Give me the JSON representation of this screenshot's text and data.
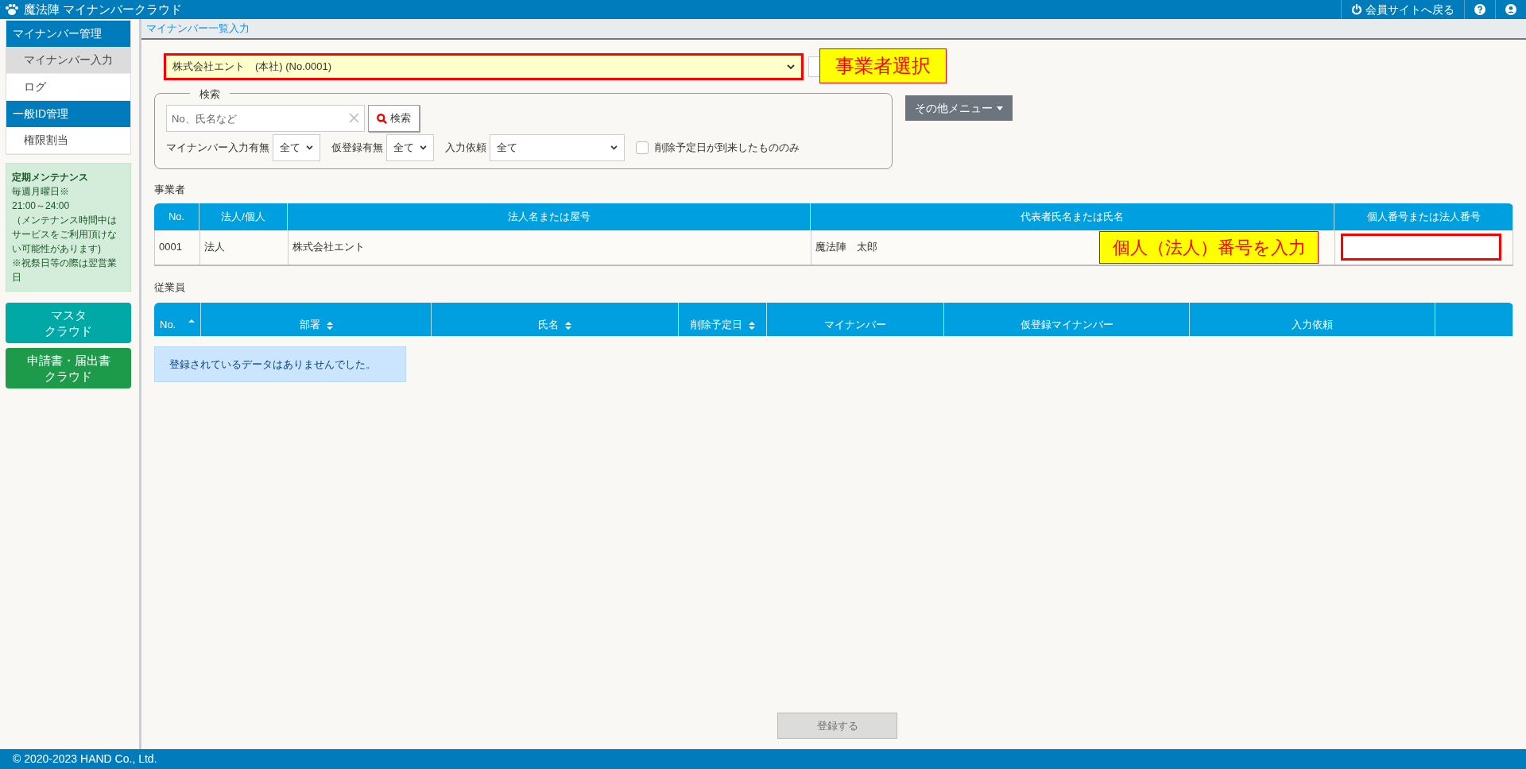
{
  "header": {
    "app_title": "魔法陣 マイナンバークラウド",
    "actions": [
      {
        "kind": "power",
        "label": "会員サイトへ戻る"
      },
      {
        "kind": "help"
      },
      {
        "kind": "user"
      }
    ]
  },
  "sidebar": {
    "groups": [
      {
        "title": "マイナンバー管理",
        "items": [
          {
            "label": "マイナンバー入力",
            "selected": true
          },
          {
            "label": "ログ",
            "selected": false
          }
        ]
      },
      {
        "title": "一般ID管理",
        "items": [
          {
            "label": "権限割当",
            "selected": false
          }
        ]
      }
    ],
    "notice": {
      "title": "定期メンテナンス",
      "lines": [
        "毎週月曜日※",
        "21:00～24:00",
        "（メンテナンス時間中はサービスをご利用頂けない可能性があります)",
        "※祝祭日等の際は翌営業日"
      ]
    },
    "links": [
      {
        "lines": [
          "マスタ",
          "クラウド"
        ],
        "color": "#00a9a5"
      },
      {
        "lines": [
          "申請書・届出書",
          "クラウド"
        ],
        "color": "#1e9a4b"
      }
    ]
  },
  "breadcrumb": "マイナンバー一覧入力",
  "company_select": {
    "value": "株式会社エント　(本社) (No.0001)"
  },
  "callouts": [
    {
      "text": "事業者選択"
    },
    {
      "text": "個人（法人）番号を入力"
    }
  ],
  "search": {
    "legend": "検索",
    "placeholder": "No、氏名など",
    "button": "検索",
    "filters": [
      {
        "kind": "select",
        "label": "マイナンバー入力有無",
        "value": "全て"
      },
      {
        "kind": "select",
        "label": "仮登録有無",
        "value": "全て"
      },
      {
        "kind": "wideselect",
        "label": "入力依頼",
        "value": "全て"
      },
      {
        "kind": "checkbox",
        "label": "削除予定日が到来したもののみ",
        "checked": false
      }
    ]
  },
  "other_menu": "その他メニュー",
  "employer": {
    "title": "事業者",
    "columns": [
      "No.",
      "法人/個人",
      "法人名または屋号",
      "代表者氏名または氏名",
      "個人番号または法人番号"
    ],
    "rows": [
      [
        "0001",
        "法人",
        "株式会社エント",
        "魔法陣　太郎"
      ]
    ]
  },
  "employees": {
    "title": "従業員",
    "columns": [
      {
        "label": "No.",
        "sortable": true,
        "sorted": true
      },
      {
        "label": "部署",
        "sortable": true,
        "sorted": false
      },
      {
        "label": "氏名",
        "sortable": true,
        "sorted": false
      },
      {
        "label": "削除予定日",
        "sortable": true,
        "sorted": false
      },
      {
        "label": "マイナンバー",
        "sortable": false,
        "sorted": false
      },
      {
        "label": "仮登録マイナンバー",
        "sortable": false,
        "sorted": false
      },
      {
        "label": "入力依頼",
        "sortable": false,
        "sorted": false
      },
      {
        "sortable": false,
        "sorted": false
      }
    ],
    "empty_message": "登録されているデータはありませんでした。"
  },
  "submit": {
    "label": "登録する",
    "disabled": true
  },
  "footer": "© 2020-2023 HAND Co., Ltd."
}
